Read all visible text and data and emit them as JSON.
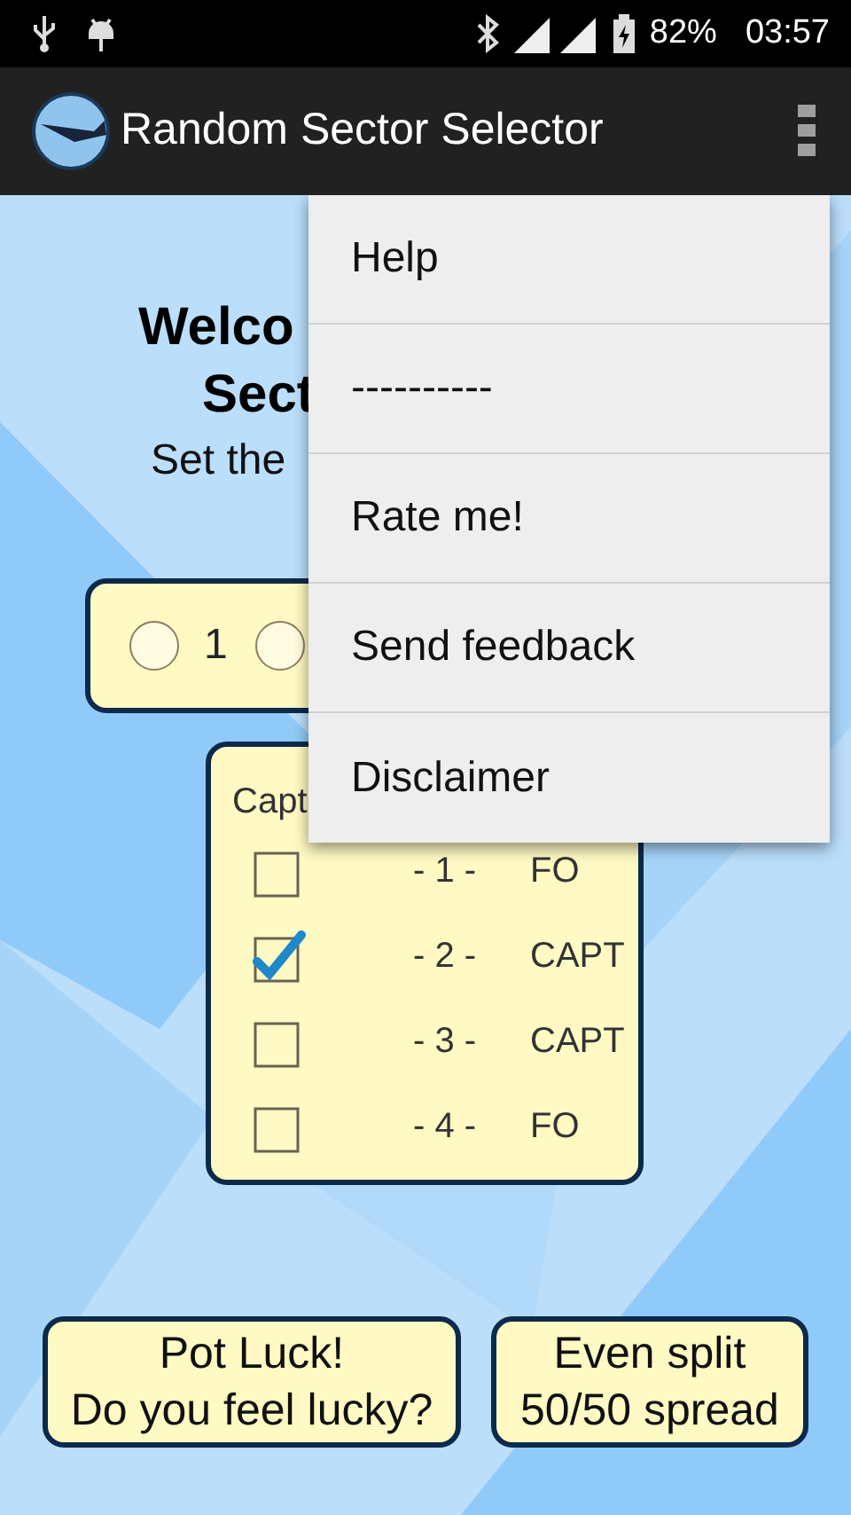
{
  "status_bar": {
    "battery": "82%",
    "time": "03:57"
  },
  "app_bar": {
    "title": "Random Sector Selector"
  },
  "welcome": {
    "title_lines": [
      "Welco",
      "Sect"
    ],
    "subtitle": "Set the"
  },
  "radio_group": {
    "options": [
      {
        "label": "1",
        "selected": false
      },
      {
        "selected": false
      }
    ]
  },
  "crew_card": {
    "header": "Capt",
    "rows": [
      {
        "checked": false,
        "sector": "- 1 -",
        "role": "FO"
      },
      {
        "checked": true,
        "sector": "- 2 -",
        "role": "CAPT"
      },
      {
        "checked": false,
        "sector": "- 3 -",
        "role": "CAPT"
      },
      {
        "checked": false,
        "sector": "- 4 -",
        "role": "FO"
      }
    ]
  },
  "buttons": [
    {
      "label": "Pot Luck!\nDo you feel lucky?"
    },
    {
      "label": "Even split\n50/50 spread"
    }
  ],
  "menu": {
    "items": [
      "Help",
      "----------",
      "Rate me!",
      "Send feedback",
      "Disclaimer"
    ]
  }
}
